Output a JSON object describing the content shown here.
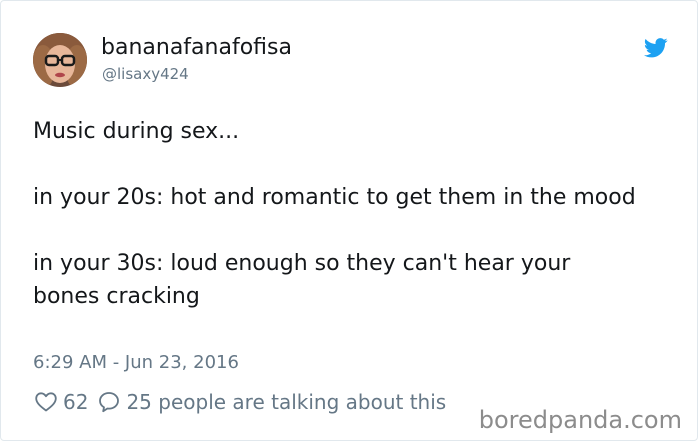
{
  "tweet": {
    "author": {
      "display_name": "bananafanafofisa",
      "handle": "@lisaxy424",
      "avatar": "profile-photo-avatar"
    },
    "paragraphs": [
      "Music during sex...",
      "in your 20s: hot and romantic to get them in the mood",
      "in your 30s: loud enough so they can't hear your bones cracking"
    ],
    "timestamp": "6:29 AM - Jun 23, 2016",
    "likes_count": "62",
    "talking_text": "25 people are talking about this",
    "icons": {
      "brand": "twitter-bird-icon",
      "like": "heart-icon",
      "reply": "speech-bubble-icon"
    }
  },
  "watermark": "boredpanda.com",
  "colors": {
    "text": "#14171a",
    "secondary": "#657786",
    "twitter_blue": "#1da1f2",
    "border": "#e1e8ed",
    "watermark": "#8c8c8c"
  }
}
